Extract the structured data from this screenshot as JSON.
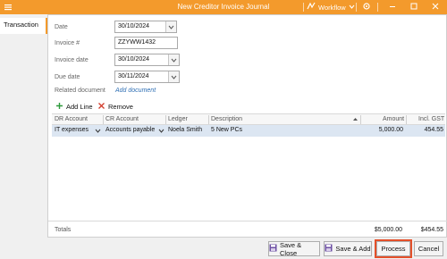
{
  "window": {
    "title": "New Creditor Invoice Journal",
    "workflow_label": "Workflow"
  },
  "tabs": [
    {
      "label": "Transaction",
      "active": true
    }
  ],
  "form": {
    "date_label": "Date",
    "date_value": "30/10/2024",
    "invoice_no_label": "Invoice #",
    "invoice_no_value": "ZZYWW1432",
    "invoice_date_label": "Invoice date",
    "invoice_date_value": "30/10/2024",
    "due_date_label": "Due date",
    "due_date_value": "30/11/2024",
    "related_doc_label": "Related document",
    "related_doc_link": "Add document"
  },
  "toolbar": {
    "add_line": "Add Line",
    "remove": "Remove"
  },
  "grid": {
    "columns": [
      "DR Account",
      "CR Account",
      "Ledger",
      "Description",
      "Amount",
      "Incl. GST"
    ],
    "rows": [
      {
        "dr_account": "IT expenses",
        "cr_account": "Accounts payable",
        "ledger": "Noela Smith",
        "description": "5 New PCs",
        "amount": "5,000.00",
        "incl_gst": "454.55"
      }
    ]
  },
  "totals": {
    "label": "Totals",
    "amount": "$5,000.00",
    "incl_gst": "$454.55"
  },
  "buttons": {
    "save_close": "Save & Close",
    "save_add": "Save & Add",
    "process": "Process",
    "cancel": "Cancel"
  },
  "colors": {
    "accent": "#f39a2c",
    "selected_row": "#dce6f2",
    "focus_outline": "#e4502a",
    "link": "#2f6fb4"
  }
}
